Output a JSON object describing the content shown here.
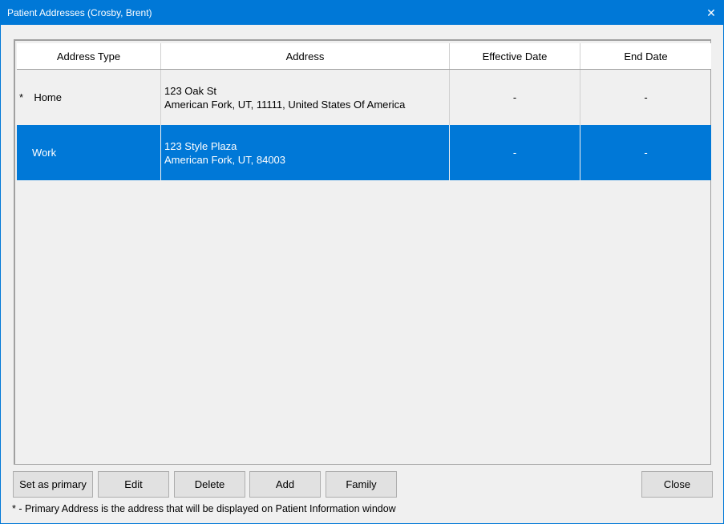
{
  "window": {
    "title": "Patient Addresses (Crosby, Brent)",
    "close_glyph": "✕",
    "accent_color": "#0078d7"
  },
  "table": {
    "columns": [
      "Address Type",
      "Address",
      "Effective Date",
      "End Date"
    ],
    "rows": [
      {
        "primary_marker": "*",
        "type": "Home",
        "address_line1": "123 Oak St",
        "address_line2": "American Fork, UT, 11111, United States Of America",
        "effective_date": "-",
        "end_date": "-",
        "selected": false
      },
      {
        "primary_marker": "",
        "type": "Work",
        "address_line1": "123 Style Plaza",
        "address_line2": "American Fork, UT, 84003",
        "effective_date": "-",
        "end_date": "-",
        "selected": true
      }
    ]
  },
  "buttons": {
    "set_primary": "Set as primary",
    "edit": "Edit",
    "delete": "Delete",
    "add": "Add",
    "family": "Family",
    "close": "Close"
  },
  "footnote": "* - Primary Address is the address that will be displayed on Patient Information window"
}
